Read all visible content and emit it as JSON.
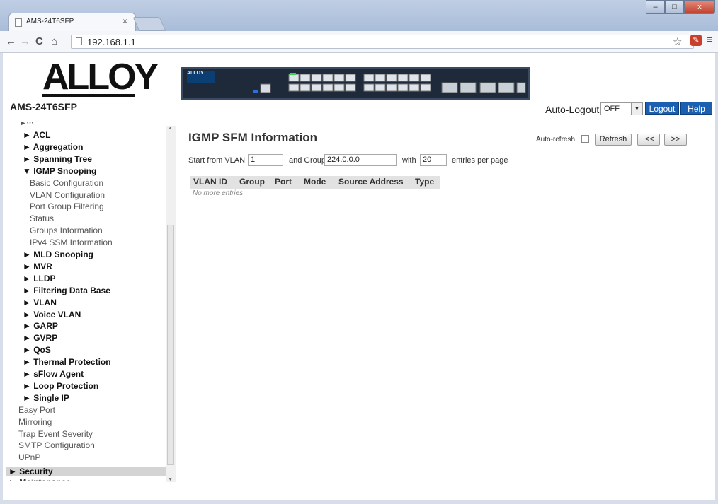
{
  "browser": {
    "tab_title": "AMS-24T6SFP",
    "tab_close": "×",
    "url": "192.168.1.1",
    "nav_back": "←",
    "nav_forward": "→",
    "nav_reload": "C",
    "nav_home": "⌂",
    "star": "☆",
    "menu": "≡",
    "win_min": "–",
    "win_max": "□",
    "win_close": "x"
  },
  "header": {
    "logo": "ALLOY",
    "model": "AMS-24T6SFP",
    "switch_label": "ALLOY",
    "auto_logout_label": "Auto-Logout",
    "auto_logout_value": "OFF",
    "logout_label": "Logout",
    "help_label": "Help"
  },
  "sidebar": {
    "items": [
      {
        "label": "► ACL",
        "kind": "item"
      },
      {
        "label": "► Aggregation",
        "kind": "item"
      },
      {
        "label": "► Spanning Tree",
        "kind": "item"
      },
      {
        "label": "▼ IGMP Snooping",
        "kind": "item"
      },
      {
        "label": "Basic Configuration",
        "kind": "sub"
      },
      {
        "label": "VLAN Configuration",
        "kind": "sub"
      },
      {
        "label": "Port Group Filtering",
        "kind": "sub"
      },
      {
        "label": "Status",
        "kind": "sub"
      },
      {
        "label": "Groups Information",
        "kind": "sub"
      },
      {
        "label": "IPv4 SSM Information",
        "kind": "sub"
      },
      {
        "label": "► MLD Snooping",
        "kind": "item"
      },
      {
        "label": "► MVR",
        "kind": "item"
      },
      {
        "label": "► LLDP",
        "kind": "item"
      },
      {
        "label": "► Filtering Data Base",
        "kind": "item"
      },
      {
        "label": "► VLAN",
        "kind": "item"
      },
      {
        "label": "► Voice VLAN",
        "kind": "item"
      },
      {
        "label": "► GARP",
        "kind": "item"
      },
      {
        "label": "► GVRP",
        "kind": "item"
      },
      {
        "label": "► QoS",
        "kind": "item"
      },
      {
        "label": "► Thermal Protection",
        "kind": "item"
      },
      {
        "label": "► sFlow Agent",
        "kind": "item"
      },
      {
        "label": "► Loop Protection",
        "kind": "item"
      },
      {
        "label": "► Single IP",
        "kind": "item"
      },
      {
        "label": "Easy Port",
        "kind": "plain"
      },
      {
        "label": "Mirroring",
        "kind": "plain"
      },
      {
        "label": "Trap Event Severity",
        "kind": "plain"
      },
      {
        "label": "SMTP Configuration",
        "kind": "plain"
      },
      {
        "label": "UPnP",
        "kind": "plain"
      }
    ],
    "security": "► Security",
    "maintenance": "► Maintenance"
  },
  "main": {
    "title": "IGMP SFM Information",
    "auto_refresh_label": "Auto-refresh",
    "refresh_label": "Refresh",
    "first_label": "|<<",
    "next_label": ">>",
    "start_from_vlan_label": "Start from VLAN",
    "start_vlan_value": "1",
    "and_group_label": "and Group",
    "group_value": "224.0.0.0",
    "with_label": "with",
    "entries_value": "20",
    "entries_per_page_label": "entries per page",
    "table_headers": [
      "VLAN ID",
      "Group",
      "Port",
      "Mode",
      "Source Address",
      "Type"
    ],
    "empty_text": "No more entries"
  },
  "colors": {
    "accent_button": "#1b5fb0",
    "table_header_bg": "#e2e2e2"
  }
}
